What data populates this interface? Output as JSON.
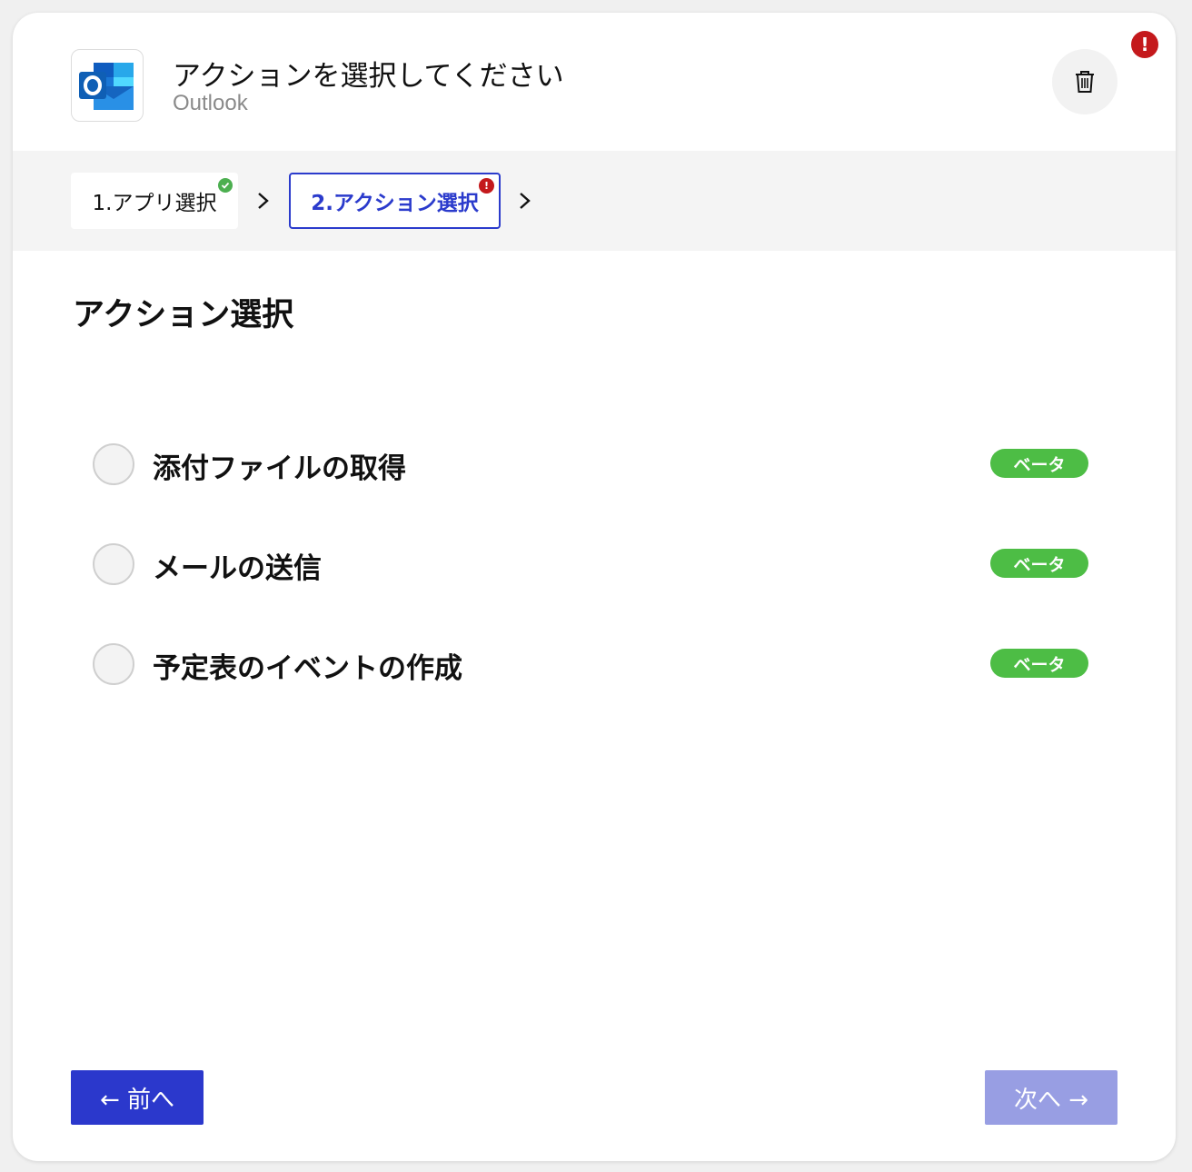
{
  "header": {
    "title": "アクションを選択してください",
    "subtitle": "Outlook",
    "app_icon": "outlook-logo",
    "delete_icon": "trash-icon",
    "error_indicator": "!"
  },
  "steps": [
    {
      "label": "1.アプリ選択",
      "status": "complete",
      "status_color": "#4caf50"
    },
    {
      "label": "2.アクション選択",
      "status": "error",
      "status_color": "#c4191c",
      "status_text": "!"
    }
  ],
  "section": {
    "title": "アクション選択"
  },
  "options": [
    {
      "label": "添付ファイルの取得",
      "badge": "ベータ",
      "selected": false
    },
    {
      "label": "メールの送信",
      "badge": "ベータ",
      "selected": false
    },
    {
      "label": "予定表のイベントの作成",
      "badge": "ベータ",
      "selected": false
    }
  ],
  "footer": {
    "prev_label": "← 前へ",
    "next_label": "次へ →",
    "next_enabled": false
  },
  "colors": {
    "accent": "#2b38cc",
    "accent_disabled": "#989ee3",
    "beta_badge": "#4dbd45",
    "error": "#c4191c",
    "success": "#4caf50"
  }
}
